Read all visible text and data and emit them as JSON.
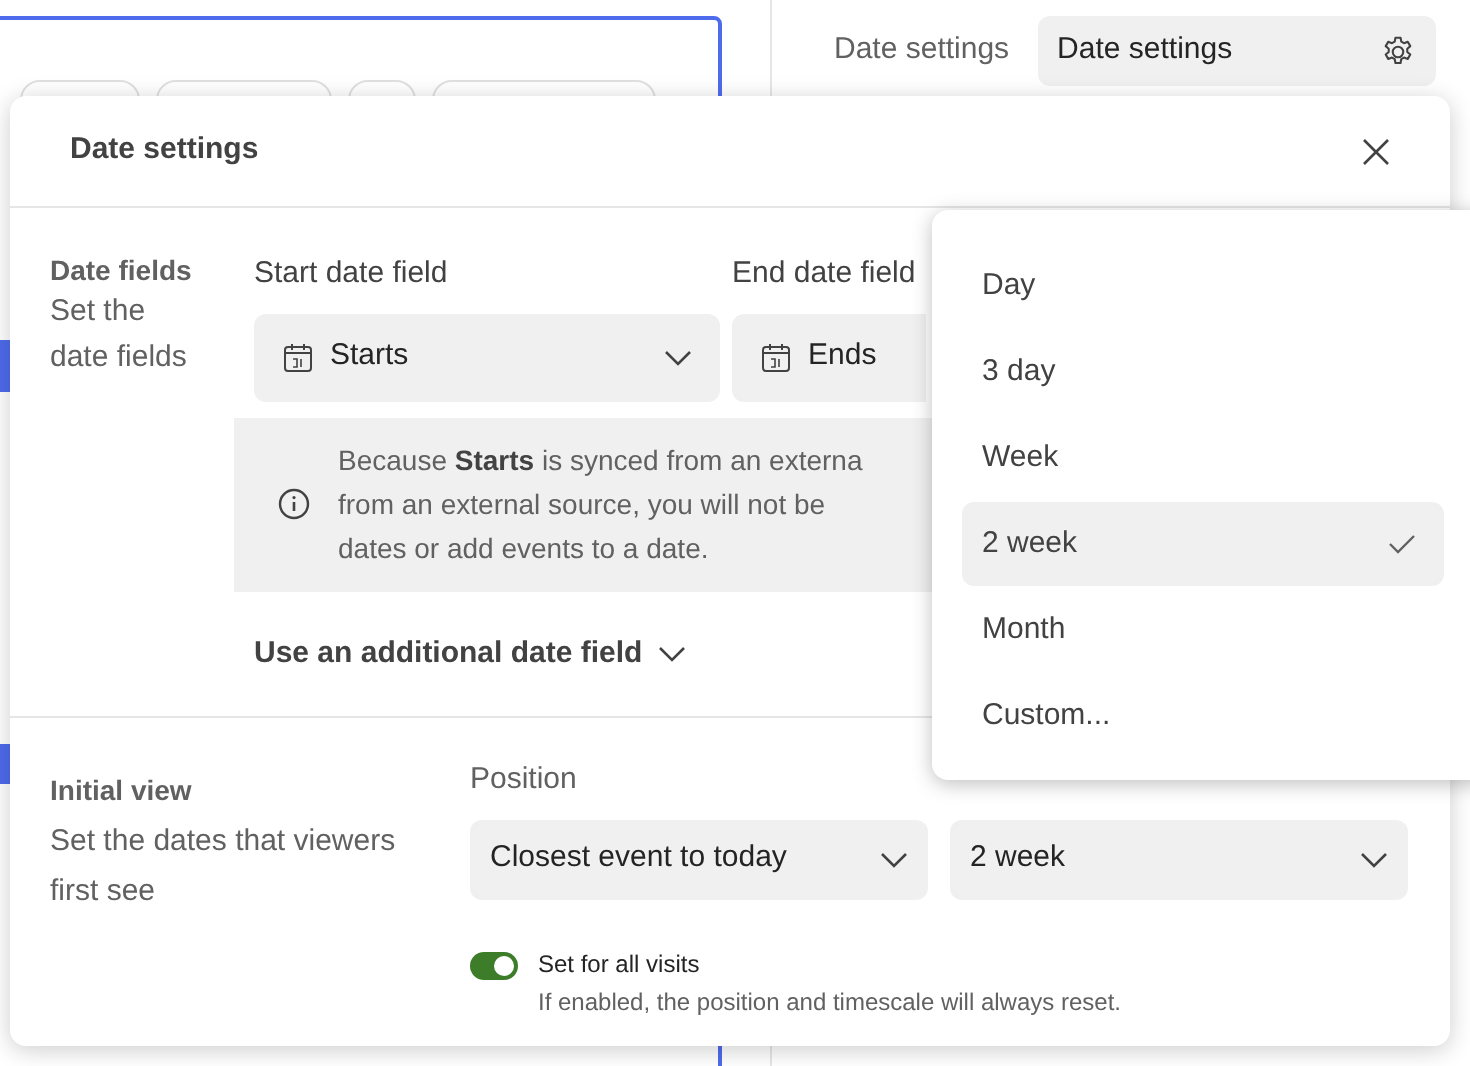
{
  "side_panel": {
    "label": "Date settings",
    "field": {
      "value": "Date settings"
    }
  },
  "dialog": {
    "title": "Date settings",
    "date_fields": {
      "heading": "Date fields",
      "description": "Set the date fields",
      "start": {
        "label": "Start date field",
        "value": "Starts"
      },
      "end": {
        "label": "End date field",
        "value": "Ends"
      },
      "info": [
        "Because **Starts** is synced from an externa",
        "from an external source, you will not be",
        "dates or add events to a date."
      ],
      "additional": "Use an additional date field"
    },
    "initial_view": {
      "heading": "Initial view",
      "description": "Set the dates that viewers first see",
      "position_label": "Position",
      "position_value": "Closest event to today",
      "timescale_value": "2 week",
      "toggle": {
        "label": "Set for all visits",
        "hint": "If enabled, the position and timescale will always reset.",
        "on": true
      }
    }
  },
  "menu": [
    {
      "label": "Day",
      "selected": false
    },
    {
      "label": "3 day",
      "selected": false
    },
    {
      "label": "Week",
      "selected": false
    },
    {
      "label": "2 week",
      "selected": true
    },
    {
      "label": "Month",
      "selected": false
    },
    {
      "label": "Custom...",
      "selected": false
    }
  ]
}
